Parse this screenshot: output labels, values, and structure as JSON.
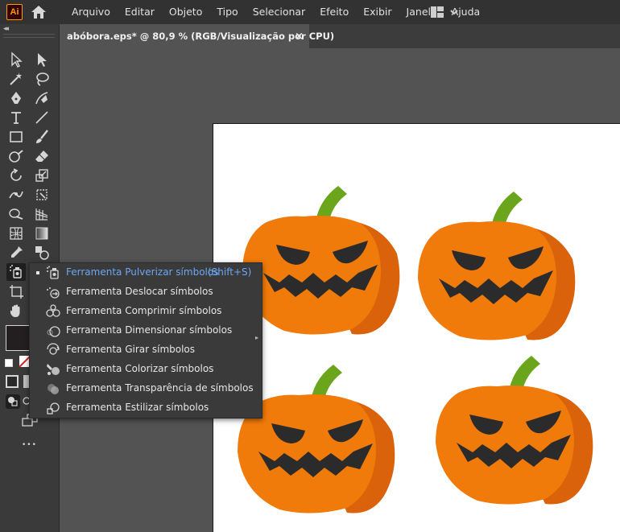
{
  "app": {
    "logo_text": "Ai"
  },
  "menu": [
    "Arquivo",
    "Editar",
    "Objeto",
    "Tipo",
    "Selecionar",
    "Efeito",
    "Exibir",
    "Janela",
    "Ajuda"
  ],
  "document": {
    "tab_title": "abóbora.eps* @ 80,9 % (RGB/Visualização por CPU)",
    "close_glyph": "×"
  },
  "toolbar": {
    "collapse_glyph": "◂◂",
    "more_glyph": "•••"
  },
  "flyout": {
    "items": [
      {
        "label": "Ferramenta Pulverizar símbolos",
        "shortcut": "(Shift+S)",
        "icon": "symbol-sprayer-icon",
        "active": true
      },
      {
        "label": "Ferramenta Deslocar símbolos",
        "icon": "symbol-shifter-icon"
      },
      {
        "label": "Ferramenta Comprimir símbolos",
        "icon": "symbol-scruncher-icon"
      },
      {
        "label": "Ferramenta Dimensionar símbolos",
        "icon": "symbol-sizer-icon"
      },
      {
        "label": "Ferramenta Girar símbolos",
        "icon": "symbol-spinner-icon"
      },
      {
        "label": "Ferramenta Colorizar símbolos",
        "icon": "symbol-stainer-icon"
      },
      {
        "label": "Ferramenta Transparência de símbolos",
        "icon": "symbol-screener-icon"
      },
      {
        "label": "Ferramenta Estilizar símbolos",
        "icon": "symbol-styler-icon"
      }
    ]
  },
  "colors": {
    "menubar": "#323232",
    "toolbar": "#3a3a3a",
    "canvas": "#535353",
    "pumpkin_main": "#f07a0a",
    "pumpkin_shade": "#d9620a",
    "stem": "#6aa51c",
    "face": "#2b2b2b",
    "accent_blue": "#6ba7f5"
  }
}
